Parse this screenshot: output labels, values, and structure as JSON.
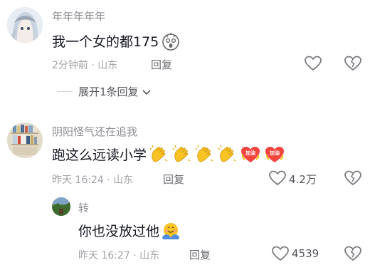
{
  "comments": [
    {
      "username": "年年年年年",
      "text": "我一个女的都175",
      "emoji": "shocked-face-emoji",
      "meta": "2分钟前 · 山东",
      "reply_label": "回复",
      "expand_label": "展开1条回复"
    },
    {
      "username": "阴阳怪气还在追我",
      "text": "跑这么远读小学",
      "emojis": [
        "clapping-hands-emoji",
        "clapping-hands-emoji",
        "clapping-hands-emoji",
        "clapping-hands-emoji",
        "jiayou-heart-sticker",
        "jiayou-heart-sticker"
      ],
      "sticker_text": "加油",
      "meta": "昨天 16:24 · 山东",
      "reply_label": "回复",
      "like_count": "4.2万"
    },
    {
      "username": "转",
      "text": "你也没放过他",
      "emoji": "hugging-face-emoji",
      "meta": "昨天 16:27 · 山东",
      "reply_label": "回复",
      "like_count": "4539"
    }
  ],
  "colors": {
    "text_primary": "#161823",
    "text_secondary": "#8a8b91",
    "text_meta": "#a1a2a7",
    "emoji_yellow": "#f7c325",
    "sticker_red": "#f2453d"
  }
}
